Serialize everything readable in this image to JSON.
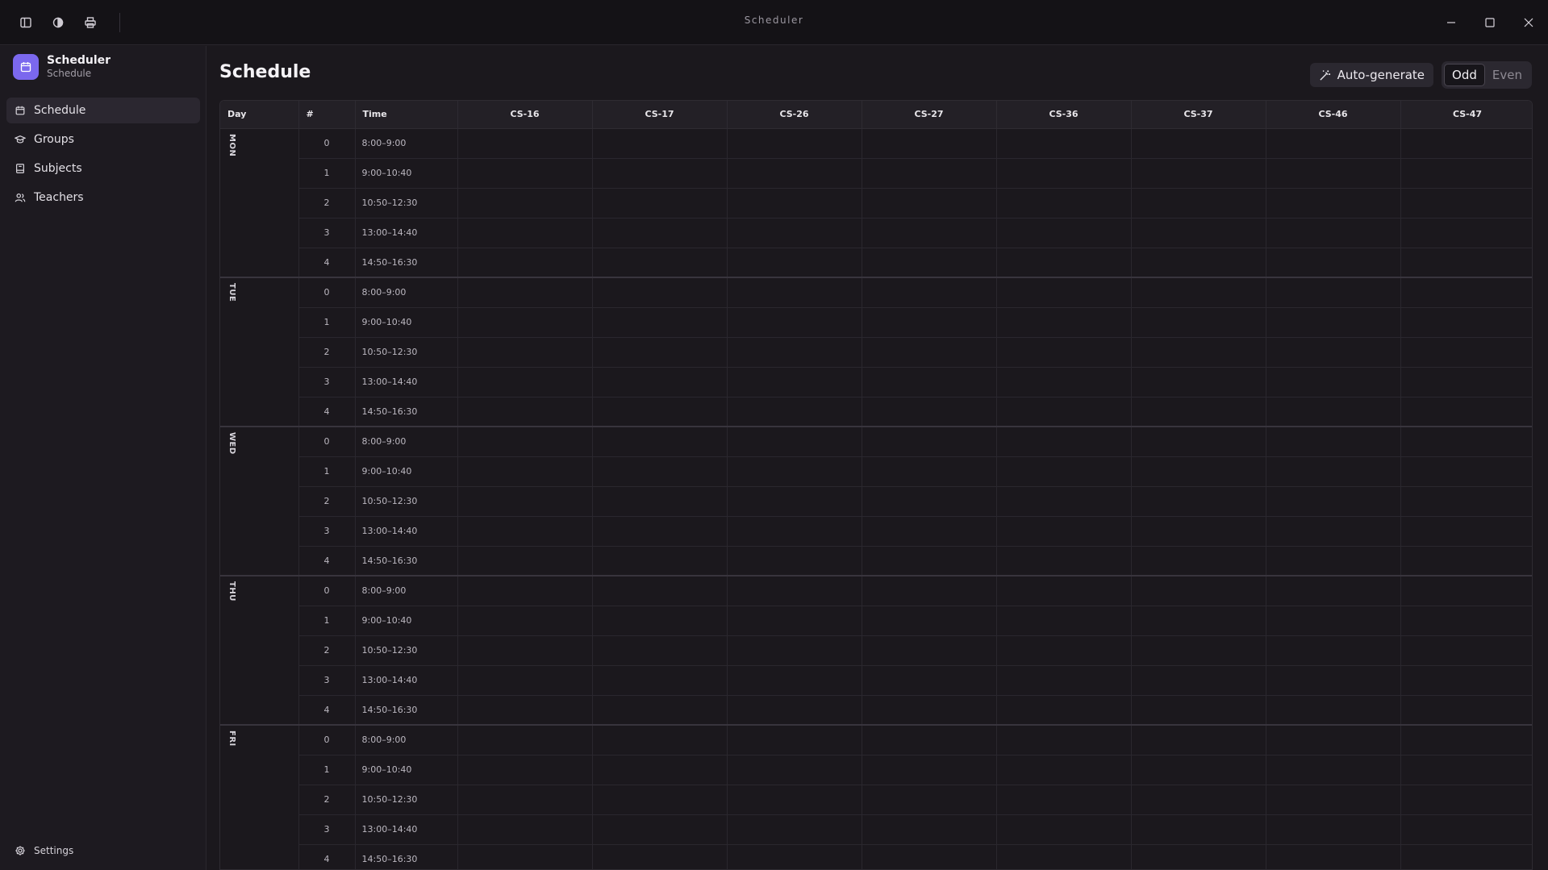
{
  "window": {
    "title": "Scheduler"
  },
  "titlebar": {
    "icons": [
      "sidebar-toggle-icon",
      "theme-icon",
      "print-icon"
    ]
  },
  "sidebar": {
    "app_name": "Scheduler",
    "app_subtitle": "Schedule",
    "items": [
      {
        "label": "Schedule",
        "icon": "calendar-icon",
        "active": true
      },
      {
        "label": "Groups",
        "icon": "graduation-cap-icon",
        "active": false
      },
      {
        "label": "Subjects",
        "icon": "book-icon",
        "active": false
      },
      {
        "label": "Teachers",
        "icon": "users-icon",
        "active": false
      }
    ],
    "settings_label": "Settings"
  },
  "main": {
    "title": "Schedule",
    "auto_generate_label": "Auto-generate",
    "week_toggle": {
      "options": [
        "Odd",
        "Even"
      ],
      "selected": "Odd"
    }
  },
  "table": {
    "headers": {
      "day": "Day",
      "num": "#",
      "time": "Time"
    },
    "groups": [
      "CS-16",
      "CS-17",
      "CS-26",
      "CS-27",
      "CS-36",
      "CS-37",
      "CS-46",
      "CS-47"
    ],
    "days": [
      "MON",
      "TUE",
      "WED",
      "THU",
      "FRI"
    ],
    "slots": [
      {
        "n": "0",
        "time": "8:00–9:00"
      },
      {
        "n": "1",
        "time": "9:00–10:40"
      },
      {
        "n": "2",
        "time": "10:50–12:30"
      },
      {
        "n": "3",
        "time": "13:00–14:40"
      },
      {
        "n": "4",
        "time": "14:50–16:30"
      }
    ]
  }
}
